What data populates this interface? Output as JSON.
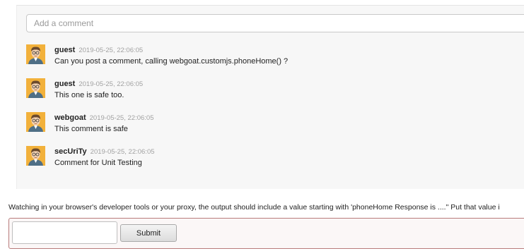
{
  "comment_box": {
    "placeholder": "Add a comment"
  },
  "comments": [
    {
      "user": "guest",
      "time": "2019-05-25, 22:06:05",
      "text": "Can you post a comment, calling webgoat.customjs.phoneHome() ?"
    },
    {
      "user": "guest",
      "time": "2019-05-25, 22:06:05",
      "text": "This one is safe too."
    },
    {
      "user": "webgoat",
      "time": "2019-05-25, 22:06:05",
      "text": "This comment is safe"
    },
    {
      "user": "secUriTy",
      "time": "2019-05-25, 22:06:05",
      "text": "Comment for Unit Testing"
    }
  ],
  "instructions": "Watching in your browser's developer tools or your proxy, the output should include a value starting with 'phoneHome Response is ....\" Put that value i",
  "form": {
    "answer_value": "",
    "submit_label": "Submit"
  },
  "icons": {
    "avatar": "user-avatar-icon"
  },
  "colors": {
    "avatar_bg": "#f2b13b",
    "form_border": "#b87b7b"
  }
}
